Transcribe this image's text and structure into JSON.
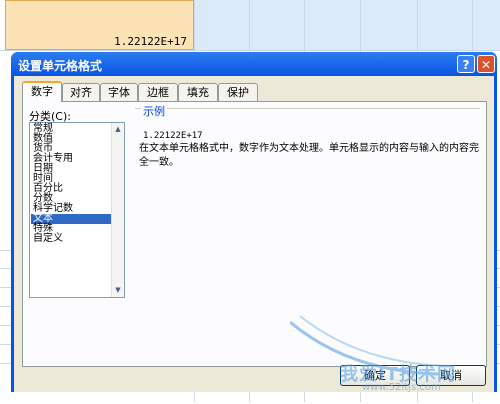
{
  "spreadsheet": {
    "active_cell_value": "1.22122E+17"
  },
  "dialog": {
    "title": "设置单元格格式",
    "help_glyph": "?",
    "close_glyph": "✕",
    "tabs": [
      "数字",
      "对齐",
      "字体",
      "边框",
      "填充",
      "保护"
    ],
    "active_tab": "数字",
    "category_label": "分类(C):",
    "categories": [
      "常规",
      "数值",
      "货币",
      "会计专用",
      "日期",
      "时间",
      "百分比",
      "分数",
      "科学记数",
      "文本",
      "特殊",
      "自定义"
    ],
    "selected_category": "文本",
    "sample_label": "示例",
    "sample_value": "1.22122E+17",
    "description": "在文本单元格格式中，数字作为文本处理。单元格显示的内容与输入的内容完全一致。",
    "ok_label": "确定",
    "cancel_label": "取消"
  },
  "watermark": {
    "text": "我爱IT技术网",
    "url": "www.52itjs.com"
  },
  "colors": {
    "titlebar": "#0a54e3",
    "selection": "#316ac5",
    "active_cell": "#fbe3b5"
  }
}
